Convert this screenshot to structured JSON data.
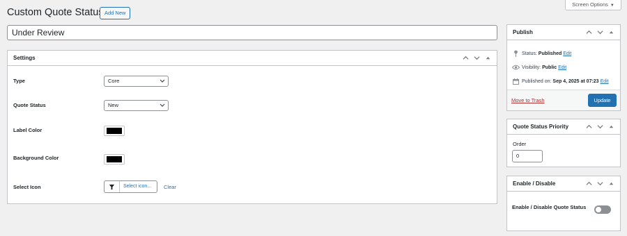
{
  "header": {
    "title": "Custom Quote Status",
    "add_new_label": "Add New",
    "screen_options_label": "Screen Options"
  },
  "title_field": {
    "value": "Under Review"
  },
  "settings": {
    "heading": "Settings",
    "fields": {
      "type": {
        "label": "Type",
        "value": "Core"
      },
      "quote_status": {
        "label": "Quote Status",
        "value": "New"
      },
      "label_color": {
        "label": "Label Color",
        "color": "#000000"
      },
      "background_color": {
        "label": "Background Color",
        "color": "#000000"
      },
      "select_icon": {
        "label": "Select Icon",
        "button_label": "Select icon...",
        "clear_label": "Clear",
        "icon": "filter-icon"
      }
    }
  },
  "publish": {
    "heading": "Publish",
    "status_label": "Status:",
    "status_value": "Published",
    "visibility_label": "Visibility:",
    "visibility_value": "Public",
    "published_label": "Published on:",
    "published_value": "Sep 4, 2025 at 07:23",
    "edit_label": "Edit",
    "trash_label": "Move to Trash",
    "update_label": "Update"
  },
  "priority": {
    "heading": "Quote Status Priority",
    "order_label": "Order",
    "order_value": "0"
  },
  "enable": {
    "heading": "Enable / Disable",
    "toggle_label": "Enable / Disable Quote Status",
    "enabled": false
  },
  "colors": {
    "accent": "#2271b1",
    "danger": "#b32d2e",
    "background": "#f0f0f1"
  }
}
